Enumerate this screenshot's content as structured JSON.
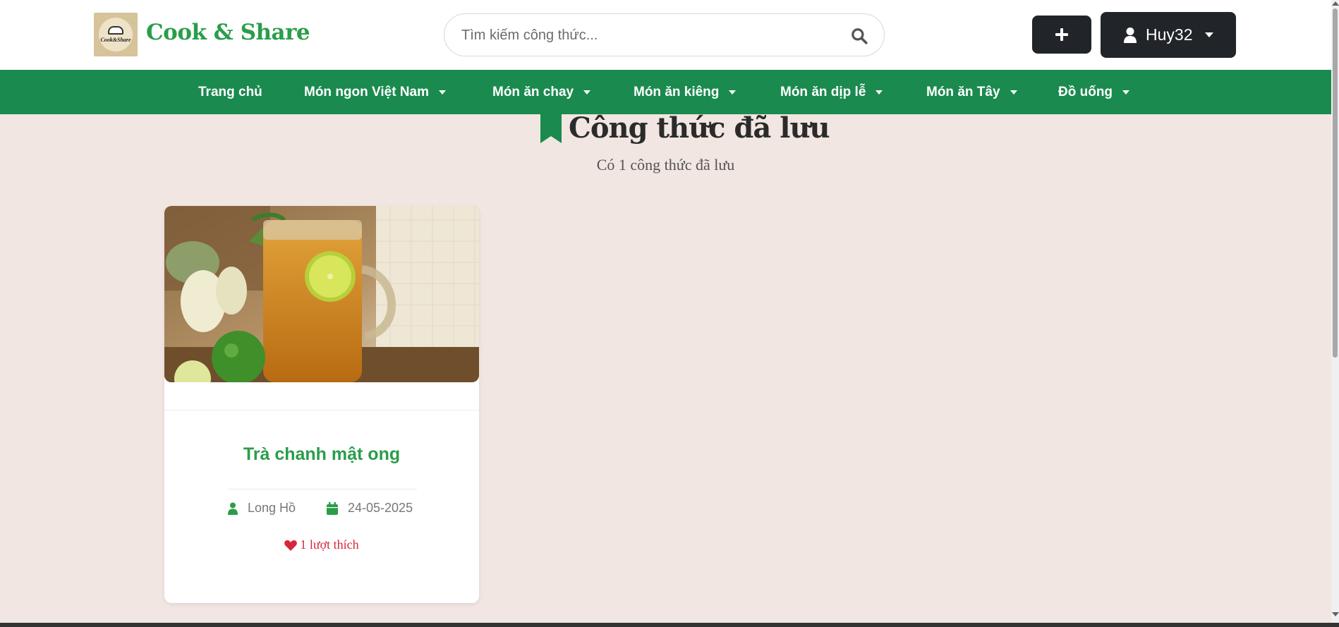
{
  "header": {
    "brand": "Cook & Share",
    "logo_text": "Cook&Share",
    "search_placeholder": "Tìm kiếm công thức...",
    "add_icon": "plus-icon",
    "user_name": "Huy32"
  },
  "nav": {
    "items": [
      {
        "label": "Trang chủ",
        "has_dropdown": false
      },
      {
        "label": "Món ngon Việt Nam",
        "has_dropdown": true
      },
      {
        "label": "Món ăn chay",
        "has_dropdown": true
      },
      {
        "label": "Món ăn kiêng",
        "has_dropdown": true
      },
      {
        "label": "Món ăn dịp lễ",
        "has_dropdown": true
      },
      {
        "label": "Món ăn Tây",
        "has_dropdown": true
      },
      {
        "label": "Đồ uống",
        "has_dropdown": true
      }
    ]
  },
  "main": {
    "title": "Công thức đã lưu",
    "subtitle": "Có 1 công thức đã lưu",
    "recipes": [
      {
        "title": "Trà chanh mật ong",
        "author": "Long Hồ",
        "date": "24-05-2025",
        "likes": "1 lượt thích"
      }
    ]
  },
  "colors": {
    "brand_green": "#2a9d4a",
    "nav_green": "#1a8a4e",
    "dark_button": "#212529",
    "like_red": "#d7263d",
    "page_bg": "#f1e6e1"
  }
}
